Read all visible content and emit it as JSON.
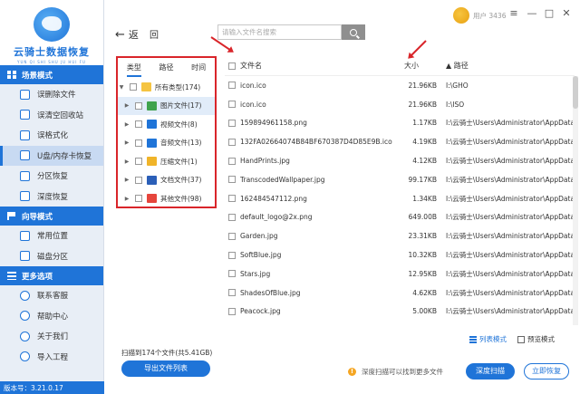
{
  "app": {
    "title": "云骑士数据恢复",
    "subtitle": "YUN QI SHI SHU JU HUI FU",
    "version": "版本号：3.21.0.17",
    "username": "用户 3436"
  },
  "sidebar": {
    "sections": [
      {
        "label": "场景模式",
        "icon": "grid-icon",
        "items": [
          {
            "label": "误删除文件"
          },
          {
            "label": "误清空回收站"
          },
          {
            "label": "误格式化"
          },
          {
            "label": "U盘/内存卡恢复",
            "active": true
          },
          {
            "label": "分区恢复"
          },
          {
            "label": "深度恢复"
          }
        ]
      },
      {
        "label": "向导模式",
        "icon": "flag-icon",
        "items": [
          {
            "label": "常用位置"
          },
          {
            "label": "磁盘分区"
          }
        ]
      },
      {
        "label": "更多选项",
        "icon": "menu-icon",
        "items": [
          {
            "label": "联系客服"
          },
          {
            "label": "帮助中心"
          },
          {
            "label": "关于我们"
          },
          {
            "label": "导入工程"
          }
        ]
      }
    ]
  },
  "toolbar": {
    "back_label": "返",
    "home_label": "回",
    "search_placeholder": "请输入文件名搜索"
  },
  "tree": {
    "tabs": [
      "类型",
      "路径",
      "时间"
    ],
    "root": {
      "label": "所有类型(174)"
    },
    "items": [
      {
        "label": "图片文件(17)",
        "color": "#3fa34d",
        "selected": true
      },
      {
        "label": "视频文件(8)",
        "color": "#1f74d8"
      },
      {
        "label": "音频文件(13)",
        "color": "#1f74d8"
      },
      {
        "label": "压缩文件(1)",
        "color": "#f0b429"
      },
      {
        "label": "文档文件(37)",
        "color": "#2b5fb8"
      },
      {
        "label": "其他文件(98)",
        "color": "#e6453c"
      }
    ]
  },
  "table": {
    "headers": {
      "name": "文件名",
      "size": "大小",
      "path": "路径"
    },
    "rows": [
      {
        "name": "icon.ico",
        "size": "21.96KB",
        "path": "I:\\GHO"
      },
      {
        "name": "icon.ico",
        "size": "21.96KB",
        "path": "I:\\ISO"
      },
      {
        "name": "159894961158.png",
        "size": "1.17KB",
        "path": "I:\\云骑士\\Users\\Administrator\\AppData\\R"
      },
      {
        "name": "132FA02664074B84BF670387D4D85E9B.ico",
        "size": "4.19KB",
        "path": "I:\\云骑士\\Users\\Administrator\\AppData\\R"
      },
      {
        "name": "HandPrints.jpg",
        "size": "4.12KB",
        "path": "I:\\云骑士\\Users\\Administrator\\AppData\\R"
      },
      {
        "name": "TranscodedWallpaper.jpg",
        "size": "99.17KB",
        "path": "I:\\云骑士\\Users\\Administrator\\AppData\\R"
      },
      {
        "name": "162484547112.png",
        "size": "1.34KB",
        "path": "I:\\云骑士\\Users\\Administrator\\AppData\\R"
      },
      {
        "name": "default_logo@2x.png",
        "size": "649.00B",
        "path": "I:\\云骑士\\Users\\Administrator\\AppData\\R"
      },
      {
        "name": "Garden.jpg",
        "size": "23.31KB",
        "path": "I:\\云骑士\\Users\\Administrator\\AppData\\R"
      },
      {
        "name": "SoftBlue.jpg",
        "size": "10.32KB",
        "path": "I:\\云骑士\\Users\\Administrator\\AppData\\R"
      },
      {
        "name": "Stars.jpg",
        "size": "12.95KB",
        "path": "I:\\云骑士\\Users\\Administrator\\AppData\\R"
      },
      {
        "name": "ShadesOfBlue.jpg",
        "size": "4.62KB",
        "path": "I:\\云骑士\\Users\\Administrator\\AppData\\R"
      },
      {
        "name": "Peacock.jpg",
        "size": "5.00KB",
        "path": "I:\\云骑士\\Users\\Administrator\\AppData\\R"
      }
    ]
  },
  "bottom": {
    "scan_info": "扫描到174个文件(共5.41GB)",
    "export_label": "导出文件列表",
    "list_mode": "列表模式",
    "preview_mode": "预览模式",
    "deep_tip": "深度扫描可以找到更多文件",
    "deep_scan_label": "深度扫描",
    "recover_now_label": "立即恢复"
  },
  "colors": {
    "accent": "#1f74d8",
    "highlight": "#d9252a"
  }
}
